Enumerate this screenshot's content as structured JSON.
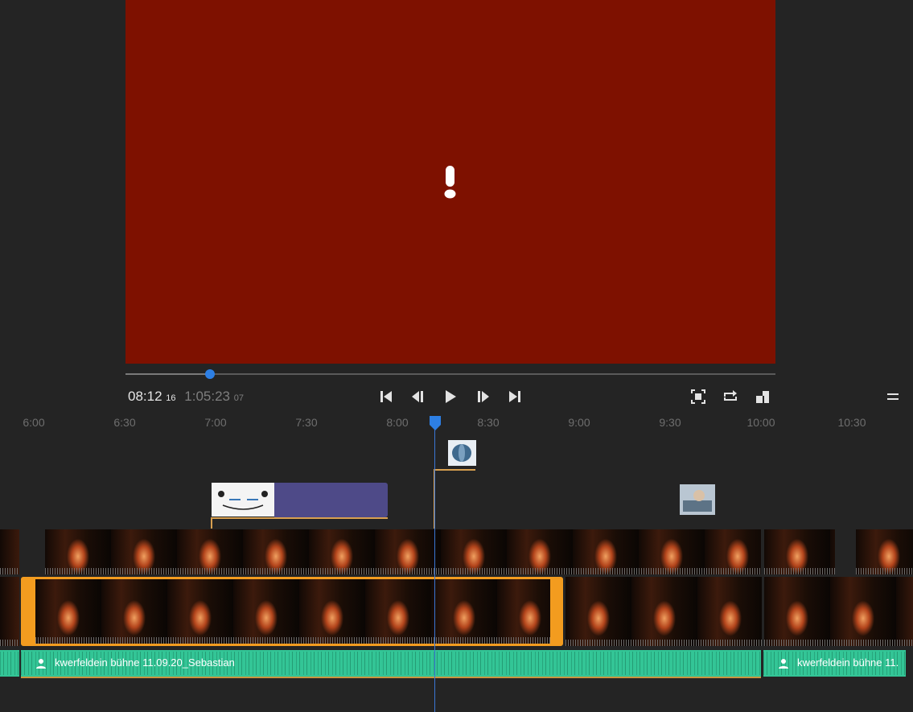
{
  "viewer": {
    "background": "#7e1100",
    "icon": "alert-icon"
  },
  "transport": {
    "current_time": "08:12",
    "current_frames": "16",
    "duration": "1:05:23",
    "duration_frames": "07",
    "progress_fraction": 0.13,
    "buttons": [
      "skip-to-start-icon",
      "step-back-icon",
      "play-icon",
      "step-forward-icon",
      "skip-to-end-icon",
      "fullscreen-icon",
      "loop-icon",
      "output-icon",
      "menu-icon"
    ]
  },
  "ruler": {
    "ticks": [
      "6:00",
      "6:30",
      "7:00",
      "7:30",
      "8:00",
      "8:30",
      "9:00",
      "9:30",
      "10:00",
      "10:30"
    ],
    "playhead_color": "#3a76d4"
  },
  "timeline": {
    "audio_clip_1_name": "kwerfeldein bühne 11.09.20_Sebastian",
    "audio_clip_2_name": "kwerfeldein bühne 11.",
    "selection_color": "#f39c1f",
    "audio_color": "#33c596",
    "title_clip_color": "#4e4a88"
  }
}
